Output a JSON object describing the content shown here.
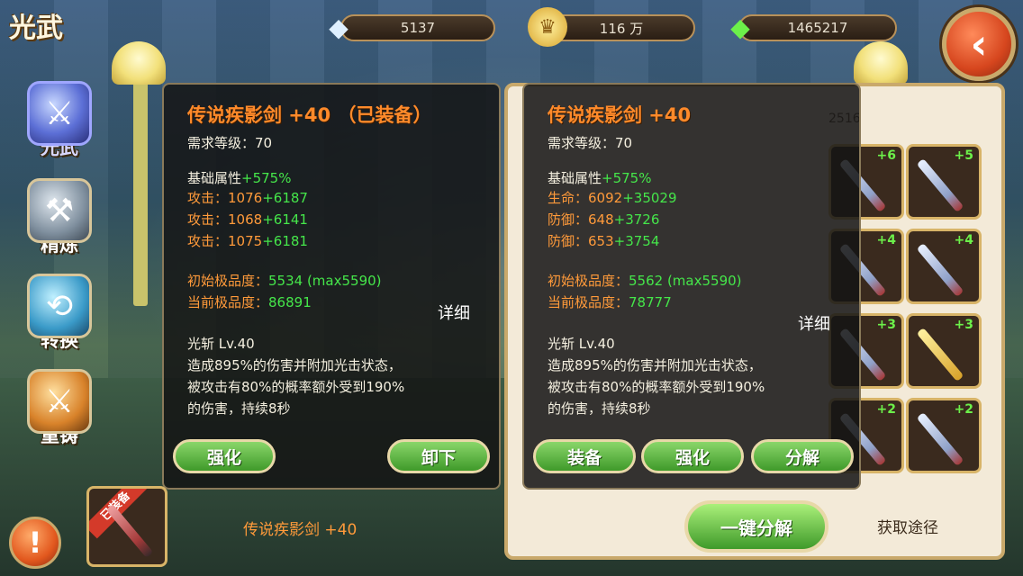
{
  "page_title": "光武",
  "currencies": [
    {
      "icon": "diamond-icon",
      "value": "5137"
    },
    {
      "icon": "crown-icon",
      "value": "116 万"
    },
    {
      "icon": "green-gem-icon",
      "value": "1465217"
    }
  ],
  "sidebar": {
    "items": [
      {
        "label": "光武",
        "icon": "weapon-emblem-icon"
      },
      {
        "label": "精炼",
        "icon": "anvil-icon"
      },
      {
        "label": "转换",
        "icon": "swap-icon"
      },
      {
        "label": "重铸",
        "icon": "forge-icon"
      }
    ]
  },
  "left_panel": {
    "title": "传说疾影剑 +40 （已装备）",
    "req_level": "需求等级：70",
    "base_label": "基础属性",
    "base_bonus": "+575%",
    "stats": [
      {
        "name": "攻击：",
        "base": "1076",
        "bonus": "+6187"
      },
      {
        "name": "攻击：",
        "base": "1068",
        "bonus": "+6141"
      },
      {
        "name": "攻击：",
        "base": "1075",
        "bonus": "+6181"
      }
    ],
    "init_quality_label": "初始极品度：",
    "init_quality_value": "5534 (max5590)",
    "cur_quality_label": "当前极品度：",
    "cur_quality_value": "86891",
    "detail": "详细",
    "skill_name": "光斩 Lv.40",
    "skill_desc": [
      "造成895%的伤害并附加光击状态，",
      "被攻击有80%的概率额外受到190%",
      "的伤害，持续8秒"
    ],
    "btn_upgrade": "强化",
    "btn_unequip": "卸下"
  },
  "right_panel": {
    "title": "传说疾影剑 +40",
    "req_level": "需求等级：70",
    "base_label": "基础属性",
    "base_bonus": "+575%",
    "stats": [
      {
        "name": "生命：",
        "base": "6092",
        "bonus": "+35029"
      },
      {
        "name": "防御：",
        "base": "648",
        "bonus": "+3726"
      },
      {
        "name": "防御：",
        "base": "653",
        "bonus": "+3754"
      }
    ],
    "init_quality_label": "初始极品度：",
    "init_quality_value": "5562 (max5590)",
    "cur_quality_label": "当前极品度：",
    "cur_quality_value": "78777",
    "detail": "详细",
    "skill_name": "光斩 Lv.40",
    "skill_desc": [
      "造成895%的伤害并附加光击状态，",
      "被攻击有80%的概率额外受到190%",
      "的伤害，持续8秒"
    ],
    "btn_equip": "装备",
    "btn_upgrade": "强化",
    "btn_decompose": "分解"
  },
  "inventory": {
    "resource_value": "2516",
    "slots_visible": [
      {
        "plus": "+6"
      },
      {
        "plus": "+5"
      },
      {
        "plus": "+4"
      },
      {
        "plus": "+4"
      },
      {
        "plus": "+3"
      },
      {
        "plus": "+3"
      },
      {
        "plus": "+2"
      },
      {
        "plus": "+2"
      }
    ],
    "one_click_decompose": "一键分解",
    "source": "获取途径"
  },
  "equipped": {
    "tag": "已装备",
    "name": "传说疾影剑 +40"
  },
  "alert_glyph": "!",
  "back_glyph": "‹"
}
